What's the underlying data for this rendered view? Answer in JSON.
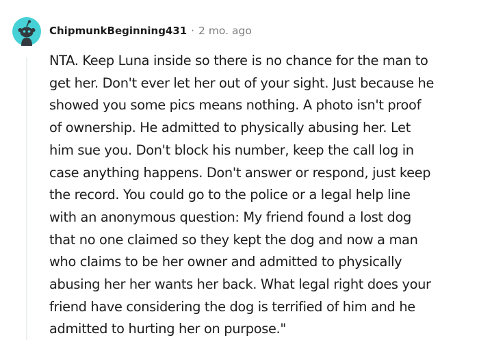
{
  "comment": {
    "author": "ChipmunkBeginning431",
    "separator": "·",
    "timestamp": "2 mo. ago",
    "avatar_icon": "reddit-snoo-avatar-icon",
    "avatar_color": "#46d1d6",
    "body_lines": [
      "NTA. Keep Luna inside so there is no chance for the man to",
      "get her. Don't ever let her out of your sight. Just because he",
      "showed you some pics means nothing. A photo isn't proof",
      "of ownership. He admitted to physically abusing her. Let",
      "him sue you. Don't block his number, keep the call log in",
      "case anything happens. Don't answer or respond, just keep",
      "the record. You could go to the police or a legal help line",
      "with an anonymous question: My friend found a lost dog",
      "that no one claimed so they kept the dog and now a man",
      "who claims to be her owner and admitted to physically",
      "abusing her her wants her back. What legal right does your",
      "friend have considering the dog is terrified of him and he",
      "admitted to hurting her on purpose.\""
    ]
  }
}
